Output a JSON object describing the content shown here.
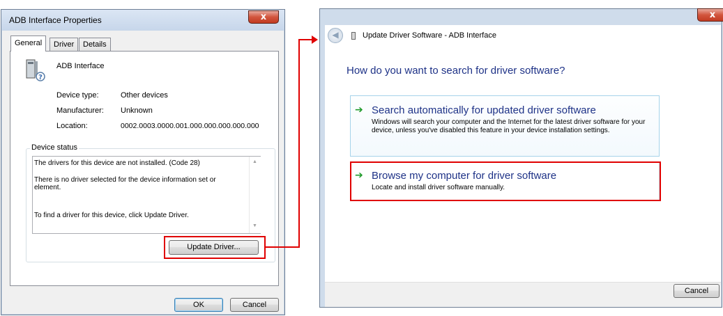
{
  "properties_dialog": {
    "title": "ADB Interface Properties",
    "close_glyph": "x",
    "tabs": [
      {
        "label": "General",
        "active": true
      },
      {
        "label": "Driver",
        "active": false
      },
      {
        "label": "Details",
        "active": false
      }
    ],
    "device_name": "ADB Interface",
    "fields": [
      {
        "label": "Device type:",
        "value": "Other devices"
      },
      {
        "label": "Manufacturer:",
        "value": "Unknown"
      },
      {
        "label": "Location:",
        "value": "0002.0003.0000.001.000.000.000.000.000"
      }
    ],
    "status_legend": "Device status",
    "status_lines": [
      "The drivers for this device are not installed. (Code 28)",
      "There is no driver selected for the device information set or element.",
      "To find a driver for this device, click Update Driver."
    ],
    "update_driver_label": "Update Driver...",
    "ok_label": "OK",
    "cancel_label": "Cancel"
  },
  "wizard": {
    "close_glyph": "x",
    "title": "Update Driver Software - ADB Interface",
    "question": "How do you want to search for driver software?",
    "options": [
      {
        "title": "Search automatically for updated driver software",
        "description": "Windows will search your computer and the Internet for the latest driver software for your device, unless you've disabled this feature in your device installation settings."
      },
      {
        "title": "Browse my computer for driver software",
        "description": "Locate and install driver software manually."
      }
    ],
    "cancel_label": "Cancel"
  },
  "colors": {
    "highlight": "#e00000",
    "link_blue": "#1e3287",
    "arrow_green": "#1f9a2a"
  },
  "icons": {
    "option_arrow": "green-right-arrow-icon",
    "back": "back-arrow-icon",
    "device": "unknown-device-icon"
  }
}
